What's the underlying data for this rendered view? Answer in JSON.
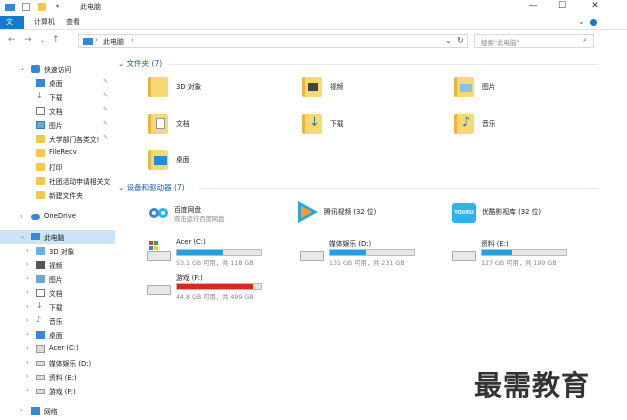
{
  "window": {
    "title": "此电脑",
    "minimize": "—",
    "maximize": "☐",
    "close": "✕"
  },
  "ribbon": {
    "tabs": [
      {
        "label": "文件",
        "active": true
      },
      {
        "label": "计算机",
        "active": false
      },
      {
        "label": "查看",
        "active": false
      }
    ]
  },
  "address": {
    "path_root": "此电脑",
    "separator": "›",
    "search_placeholder": "搜索\"此电脑\""
  },
  "nav": {
    "quick_access": "快速访问",
    "quick_items": [
      "桌面",
      "下载",
      "文档",
      "图片",
      "大学部门各类文!",
      "FileRecv",
      "打印",
      "社团活动申请相关文",
      "新建文件夹"
    ],
    "onedrive": "OneDrive",
    "this_pc": "此电脑",
    "pc_items": [
      "3D 对象",
      "视频",
      "图片",
      "文档",
      "下载",
      "音乐",
      "桌面",
      "Acer (C:)",
      "媒体娱乐 (D:)",
      "资料 (E:)",
      "游戏 (F:)"
    ],
    "network": "网络"
  },
  "folders_section": {
    "heading": "文件夹 (7)",
    "items": [
      "3D 对象",
      "视频",
      "图片",
      "文档",
      "下载",
      "音乐",
      "桌面"
    ]
  },
  "devices_section": {
    "heading": "设备和驱动器 (7)",
    "apps": [
      {
        "name": "百度网盘",
        "sub": "双击运行百度网盘"
      },
      {
        "name": "腾讯视频 (32 位)",
        "sub": ""
      },
      {
        "name": "优酷影视库 (32 位)",
        "sub": ""
      }
    ],
    "drives": [
      {
        "name": "Acer (C:)",
        "free": "53.1 GB 可用，共 118 GB",
        "used_fraction": 0.55,
        "color": "#26a0da"
      },
      {
        "name": "媒体娱乐 (D:)",
        "free": "131 GB 可用，共 231 GB",
        "used_fraction": 0.43,
        "color": "#26a0da"
      },
      {
        "name": "资料 (E:)",
        "free": "127 GB 可用，共 199 GB",
        "used_fraction": 0.36,
        "color": "#26a0da"
      },
      {
        "name": "游戏 (F:)",
        "free": "44.8 GB 可用，共 499 GB",
        "used_fraction": 0.91,
        "color": "#da2626"
      }
    ]
  },
  "watermark": "最需教育"
}
